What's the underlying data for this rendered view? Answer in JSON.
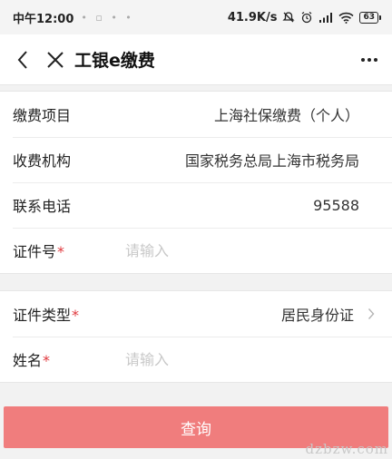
{
  "status_bar": {
    "time": "中午12:00",
    "notification_dots": "• ▫ • •",
    "network_speed": "41.9K/s",
    "battery_level": "63"
  },
  "nav": {
    "title": "工银e缴费",
    "back_icon": "chevron-left-icon",
    "close_icon": "close-icon",
    "more_icon": "more-dots-icon"
  },
  "info_group": {
    "rows": [
      {
        "label": "缴费项目",
        "value": "上海社保缴费（个人）"
      },
      {
        "label": "收费机构",
        "value": "国家税务总局上海市税务局"
      },
      {
        "label": "联系电话",
        "value": "95588"
      }
    ],
    "id_number": {
      "label": "证件号",
      "required_mark": "*",
      "placeholder": "请输入",
      "value": ""
    }
  },
  "identity_group": {
    "id_type": {
      "label": "证件类型",
      "required_mark": "*",
      "value": "居民身份证"
    },
    "name": {
      "label": "姓名",
      "required_mark": "*",
      "placeholder": "请输入",
      "value": ""
    }
  },
  "query_button": {
    "label": "查询",
    "color": "#f07d7d"
  },
  "watermark": "dzbzw.com"
}
